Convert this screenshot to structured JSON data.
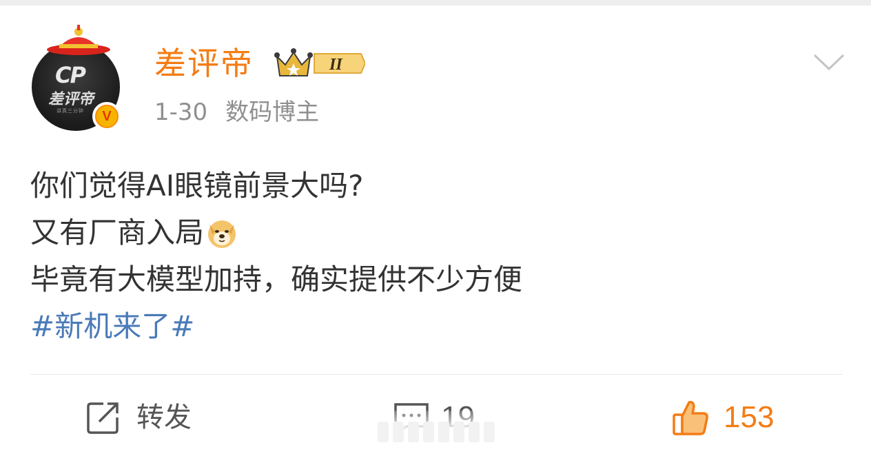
{
  "post": {
    "author": {
      "name": "差评帝",
      "avatar_text": "CP",
      "avatar_name": "差评帝",
      "avatar_sub": "讲真三分钟",
      "verified_mark": "V",
      "rank_label": "II"
    },
    "meta": {
      "date": "1-30",
      "source": "数码博主"
    },
    "content": {
      "line1": "你们觉得AI眼镜前景大吗?",
      "line2": "又有厂商入局",
      "line3": "毕竟有大模型加持，确实提供不少方便",
      "hashtag": "#新机来了#"
    },
    "actions": {
      "repost_label": "转发",
      "comment_count": "19",
      "like_count": "153"
    },
    "icons": {
      "dropdown": "chevron-down-icon",
      "repost": "share-icon",
      "comment": "comment-icon",
      "like": "thumbs-up-icon",
      "emoji": "doge-emoji-icon",
      "crown": "crown-icon",
      "verified": "verified-v-icon"
    },
    "colors": {
      "username": "#f47c14",
      "hashtag": "#4a7ab8",
      "text": "#333333",
      "meta": "#8f8f8f",
      "like": "#f47c14"
    }
  }
}
